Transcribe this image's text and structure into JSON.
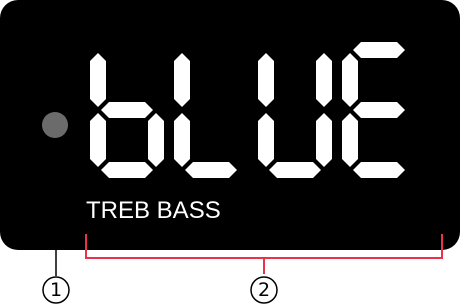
{
  "display": {
    "text": "bLUE",
    "mode_label": "TREB BASS",
    "indicator_color": "#6b6b6b",
    "panel_color": "#000000",
    "segment_color": "#ffffff"
  },
  "callouts": [
    {
      "number": "1",
      "target": "indicator-dot"
    },
    {
      "number": "2",
      "target": "display-digits"
    }
  ],
  "accent_color": "#e8334a"
}
